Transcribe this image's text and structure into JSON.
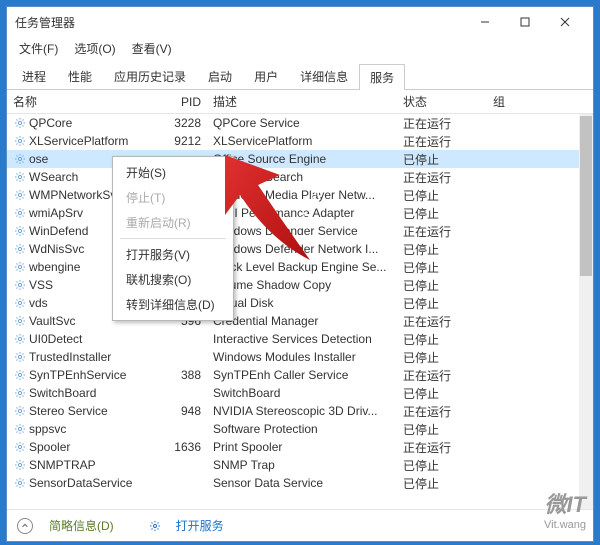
{
  "window": {
    "title": "任务管理器"
  },
  "menu": {
    "file": "文件(F)",
    "options": "选项(O)",
    "view": "查看(V)"
  },
  "tabs": [
    "进程",
    "性能",
    "应用历史记录",
    "启动",
    "用户",
    "详细信息",
    "服务"
  ],
  "active_tab": 6,
  "columns": {
    "name": "名称",
    "pid": "PID",
    "desc": "描述",
    "status": "状态",
    "group": "组"
  },
  "rows": [
    {
      "name": "QPCore",
      "pid": "3228",
      "desc": "QPCore Service",
      "status": "正在运行"
    },
    {
      "name": "XLServicePlatform",
      "pid": "9212",
      "desc": "XLServicePlatform",
      "status": "正在运行"
    },
    {
      "name": "ose",
      "pid": "",
      "desc": "Office Source Engine",
      "status": "已停止",
      "selected": true
    },
    {
      "name": "WSearch",
      "pid": "",
      "desc": "Windows Search",
      "status": "正在运行"
    },
    {
      "name": "WMPNetworkSvc",
      "pid": "",
      "desc": "Windows Media Player Netw...",
      "status": "已停止"
    },
    {
      "name": "wmiApSrv",
      "pid": "",
      "desc": "WMI Performance Adapter",
      "status": "已停止"
    },
    {
      "name": "WinDefend",
      "pid": "",
      "desc": "Windows Defender Service",
      "status": "正在运行"
    },
    {
      "name": "WdNisSvc",
      "pid": "",
      "desc": "Windows Defender Network I...",
      "status": "已停止"
    },
    {
      "name": "wbengine",
      "pid": "",
      "desc": "Block Level Backup Engine Se...",
      "status": "已停止"
    },
    {
      "name": "VSS",
      "pid": "",
      "desc": "Volume Shadow Copy",
      "status": "已停止"
    },
    {
      "name": "vds",
      "pid": "",
      "desc": "Virtual Disk",
      "status": "已停止"
    },
    {
      "name": "VaultSvc",
      "pid": "596",
      "desc": "Credential Manager",
      "status": "正在运行"
    },
    {
      "name": "UI0Detect",
      "pid": "",
      "desc": "Interactive Services Detection",
      "status": "已停止"
    },
    {
      "name": "TrustedInstaller",
      "pid": "",
      "desc": "Windows Modules Installer",
      "status": "已停止"
    },
    {
      "name": "SynTPEnhService",
      "pid": "388",
      "desc": "SynTPEnh Caller Service",
      "status": "正在运行"
    },
    {
      "name": "SwitchBoard",
      "pid": "",
      "desc": "SwitchBoard",
      "status": "已停止"
    },
    {
      "name": "Stereo Service",
      "pid": "948",
      "desc": "NVIDIA Stereoscopic 3D Driv...",
      "status": "正在运行"
    },
    {
      "name": "sppsvc",
      "pid": "",
      "desc": "Software Protection",
      "status": "已停止"
    },
    {
      "name": "Spooler",
      "pid": "1636",
      "desc": "Print Spooler",
      "status": "正在运行"
    },
    {
      "name": "SNMPTRAP",
      "pid": "",
      "desc": "SNMP Trap",
      "status": "已停止"
    },
    {
      "name": "SensorDataService",
      "pid": "",
      "desc": "Sensor Data Service",
      "status": "已停止"
    }
  ],
  "context_menu": {
    "start": "开始(S)",
    "stop": "停止(T)",
    "restart": "重新启动(R)",
    "open": "打开服务(V)",
    "search": "联机搜索(O)",
    "details": "转到详细信息(D)"
  },
  "footer": {
    "brief": "简略信息(D)",
    "open_services": "打开服务"
  },
  "watermark": {
    "center": "vit.wang",
    "corner_big": "微IT",
    "corner_small": "Vit.wang"
  }
}
